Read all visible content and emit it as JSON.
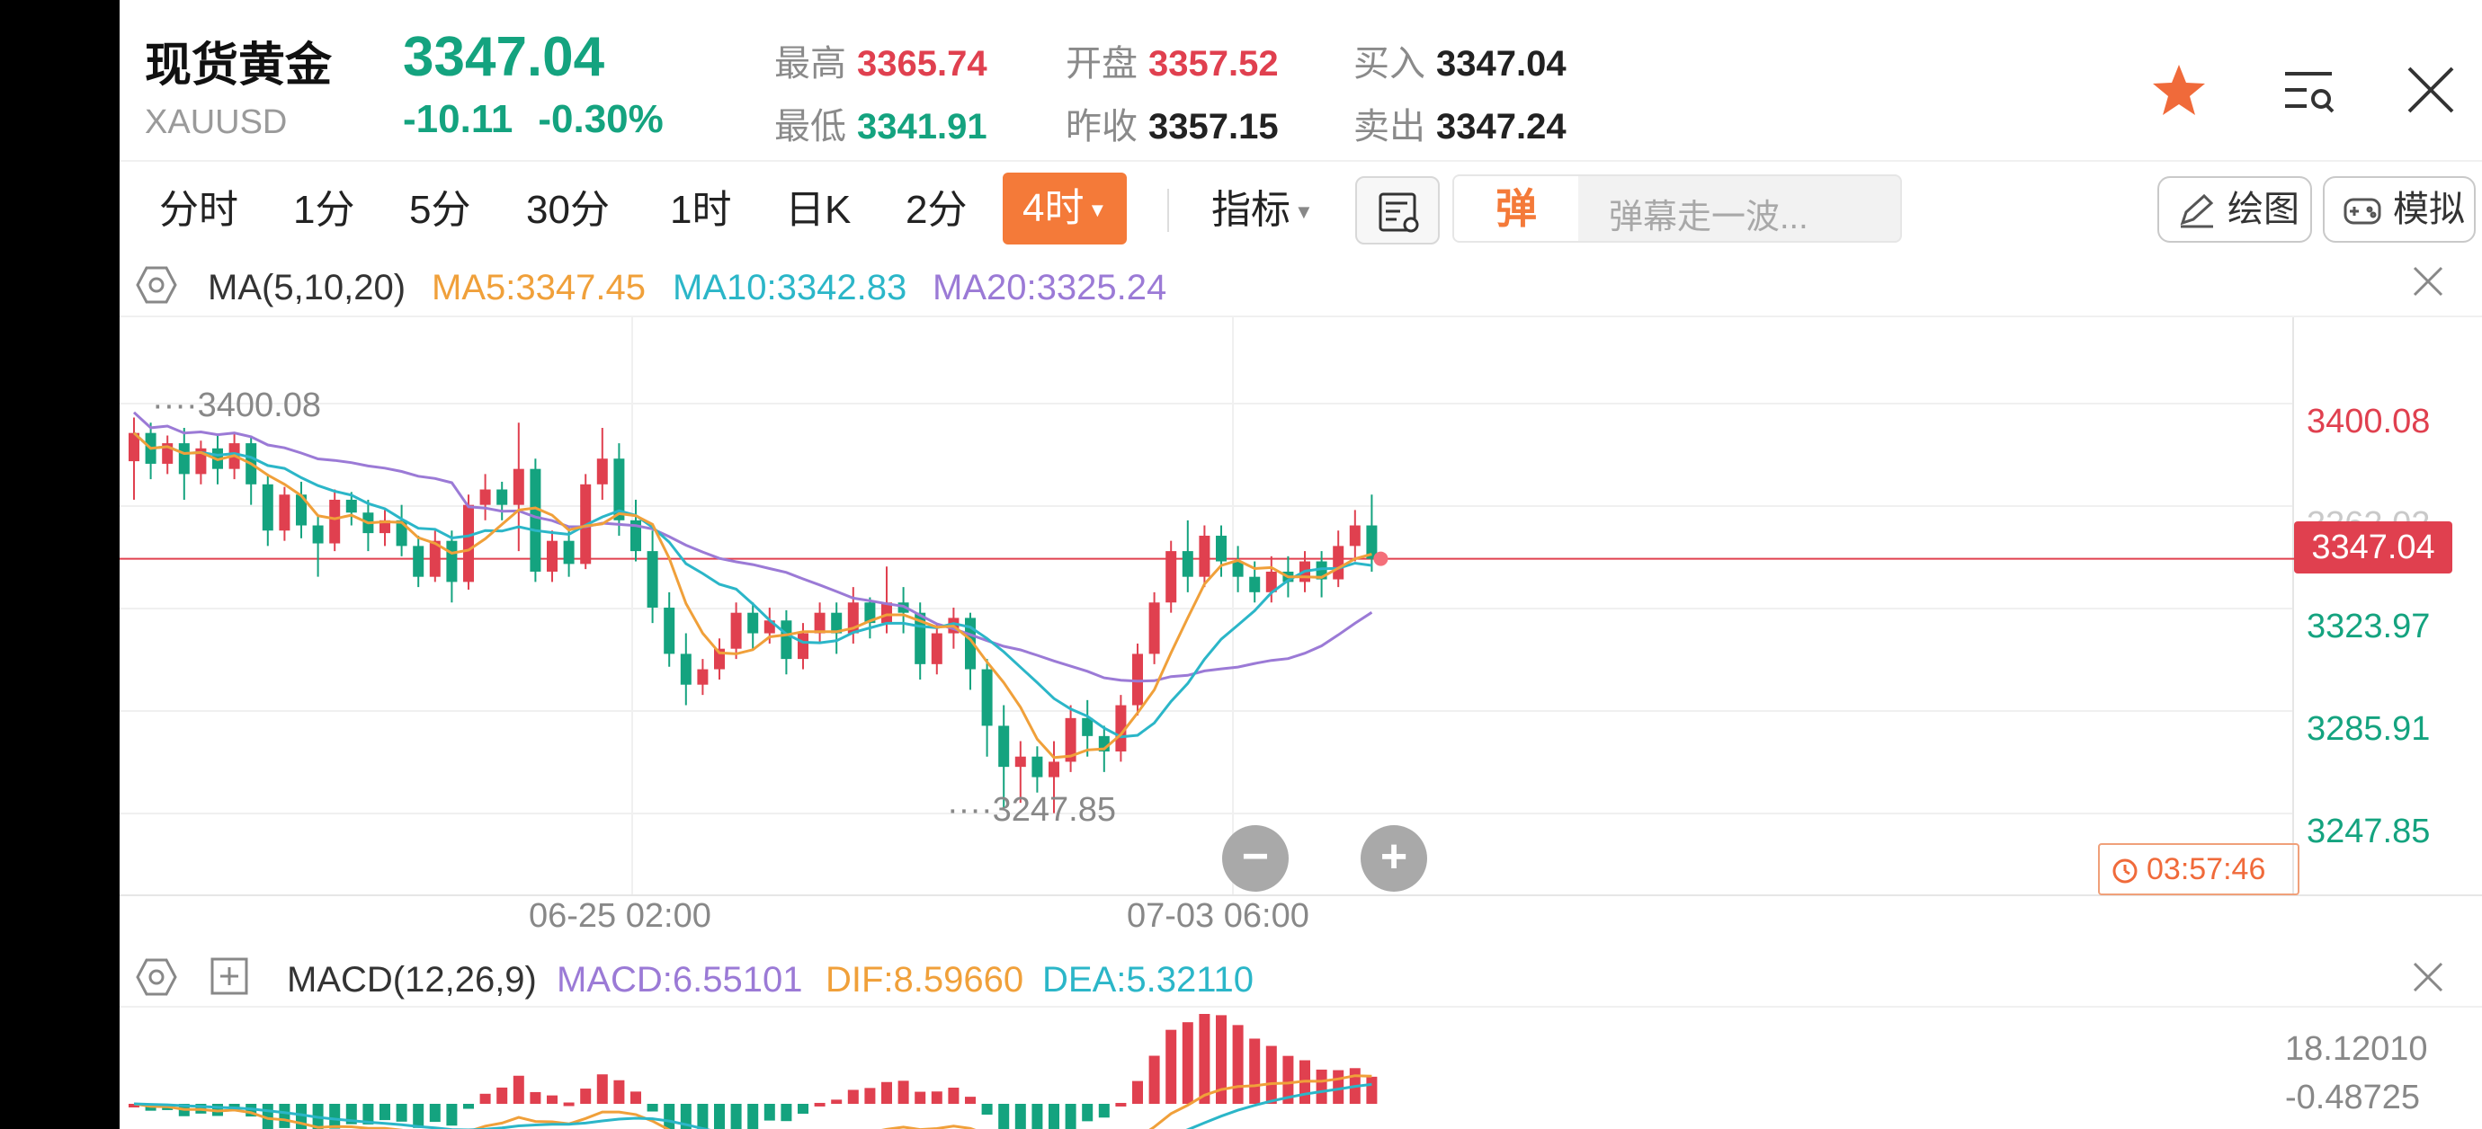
{
  "header": {
    "title": "现货黄金",
    "code": "XAUUSD",
    "price": "3347.04",
    "change": "-10.11",
    "change_pct": "-0.30%",
    "high_label": "最高",
    "high": "3365.74",
    "low_label": "最低",
    "low": "3341.91",
    "open_label": "开盘",
    "open": "3357.52",
    "prev_close_label": "昨收",
    "prev_close": "3357.15",
    "buy_label": "买入",
    "buy": "3347.04",
    "sell_label": "卖出",
    "sell": "3347.24",
    "icons": [
      "star-icon",
      "settings-list-icon",
      "close-icon"
    ]
  },
  "tabs": {
    "items": [
      "分时",
      "1分",
      "5分",
      "30分",
      "1时",
      "日K",
      "2分"
    ],
    "active": "4时",
    "indicator": "指标",
    "danmu_tag": "弹",
    "danmu_placeholder": "弹幕走一波...",
    "draw": "绘图",
    "simulate": "模拟"
  },
  "ma": {
    "name": "MA(5,10,20)",
    "ma5": "MA5:3347.45",
    "ma10": "MA10:3342.83",
    "ma20": "MA20:3325.24"
  },
  "price_axis": {
    "labels": [
      "3400.08",
      "3362.02",
      "3323.97",
      "3285.91",
      "3247.85"
    ],
    "current": "3347.04",
    "high_marker": "3400.08",
    "low_marker": "3247.85"
  },
  "time_axis": [
    "06-25 02:00",
    "07-03 06:00"
  ],
  "timer": "03:57:46",
  "zoom": {
    "minus": "−",
    "plus": "+"
  },
  "macd": {
    "name": "MACD(12,26,9)",
    "macd": "MACD:6.55101",
    "dif": "DIF:8.59660",
    "dea": "DEA:5.32110",
    "axis_top": "18.12010",
    "axis_bottom": "-0.48725"
  },
  "colors": {
    "up": "#e0404f",
    "down": "#14a37f",
    "accent": "#f47a39",
    "ma5": "#f0a03a",
    "ma10": "#2bb6c8",
    "ma20": "#9b7ad6"
  },
  "candles": [
    [
      3385,
      3396,
      3370,
      3402
    ],
    [
      3396,
      3384,
      3378,
      3400
    ],
    [
      3384,
      3392,
      3380,
      3395
    ],
    [
      3392,
      3380,
      3370,
      3398
    ],
    [
      3380,
      3390,
      3376,
      3393
    ],
    [
      3390,
      3382,
      3376,
      3395
    ],
    [
      3382,
      3392,
      3378,
      3396
    ],
    [
      3392,
      3376,
      3368,
      3395
    ],
    [
      3376,
      3358,
      3352,
      3380
    ],
    [
      3358,
      3372,
      3354,
      3375
    ],
    [
      3372,
      3360,
      3355,
      3377
    ],
    [
      3360,
      3353,
      3340,
      3364
    ],
    [
      3353,
      3370,
      3350,
      3374
    ],
    [
      3370,
      3365,
      3360,
      3373
    ],
    [
      3365,
      3357,
      3350,
      3370
    ],
    [
      3357,
      3362,
      3352,
      3366
    ],
    [
      3362,
      3352,
      3348,
      3368
    ],
    [
      3352,
      3340,
      3336,
      3356
    ],
    [
      3340,
      3354,
      3338,
      3358
    ],
    [
      3354,
      3338,
      3330,
      3358
    ],
    [
      3338,
      3368,
      3335,
      3372
    ],
    [
      3368,
      3374,
      3362,
      3380
    ],
    [
      3374,
      3368,
      3362,
      3377
    ],
    [
      3368,
      3382,
      3350,
      3400
    ],
    [
      3382,
      3342,
      3338,
      3386
    ],
    [
      3342,
      3354,
      3338,
      3358
    ],
    [
      3354,
      3345,
      3340,
      3360
    ],
    [
      3345,
      3376,
      3343,
      3380
    ],
    [
      3376,
      3386,
      3370,
      3398
    ],
    [
      3386,
      3362,
      3356,
      3392
    ],
    [
      3362,
      3350,
      3346,
      3370
    ],
    [
      3350,
      3328,
      3322,
      3358
    ],
    [
      3328,
      3310,
      3305,
      3334
    ],
    [
      3310,
      3298,
      3290,
      3318
    ],
    [
      3298,
      3304,
      3294,
      3308
    ],
    [
      3304,
      3312,
      3300,
      3316
    ],
    [
      3312,
      3326,
      3308,
      3330
    ],
    [
      3326,
      3318,
      3312,
      3330
    ],
    [
      3318,
      3323,
      3314,
      3328
    ],
    [
      3323,
      3308,
      3302,
      3327
    ],
    [
      3308,
      3318,
      3304,
      3322
    ],
    [
      3318,
      3326,
      3314,
      3330
    ],
    [
      3326,
      3318,
      3310,
      3330
    ],
    [
      3318,
      3330,
      3314,
      3336
    ],
    [
      3330,
      3322,
      3316,
      3332
    ],
    [
      3322,
      3330,
      3318,
      3344
    ],
    [
      3330,
      3326,
      3318,
      3336
    ],
    [
      3326,
      3306,
      3300,
      3330
    ],
    [
      3306,
      3318,
      3302,
      3322
    ],
    [
      3318,
      3324,
      3312,
      3328
    ],
    [
      3324,
      3304,
      3296,
      3326
    ],
    [
      3304,
      3282,
      3270,
      3308
    ],
    [
      3282,
      3266,
      3250,
      3290
    ],
    [
      3266,
      3270,
      3252,
      3276
    ],
    [
      3270,
      3262,
      3256,
      3274
    ],
    [
      3262,
      3268,
      3248,
      3276
    ],
    [
      3268,
      3285,
      3264,
      3290
    ],
    [
      3285,
      3278,
      3270,
      3292
    ],
    [
      3278,
      3272,
      3264,
      3282
    ],
    [
      3272,
      3290,
      3268,
      3294
    ],
    [
      3290,
      3310,
      3286,
      3314
    ],
    [
      3310,
      3330,
      3306,
      3334
    ],
    [
      3330,
      3350,
      3326,
      3354
    ],
    [
      3350,
      3340,
      3334,
      3362
    ],
    [
      3340,
      3356,
      3336,
      3360
    ],
    [
      3356,
      3346,
      3340,
      3360
    ],
    [
      3346,
      3340,
      3334,
      3352
    ],
    [
      3340,
      3334,
      3330,
      3346
    ],
    [
      3334,
      3342,
      3330,
      3348
    ],
    [
      3342,
      3338,
      3332,
      3348
    ],
    [
      3338,
      3346,
      3334,
      3350
    ],
    [
      3346,
      3339,
      3332,
      3350
    ],
    [
      3339,
      3352,
      3336,
      3358
    ],
    [
      3352,
      3360,
      3346,
      3366
    ],
    [
      3360,
      3347,
      3342,
      3372
    ]
  ]
}
